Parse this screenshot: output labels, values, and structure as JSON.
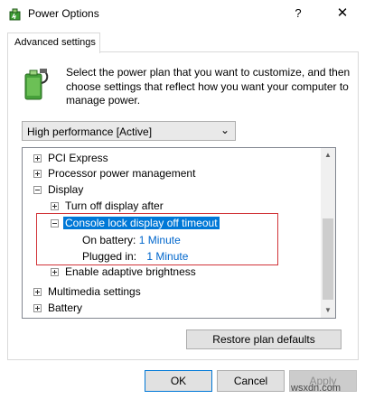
{
  "window": {
    "title": "Power Options",
    "help": "?",
    "close": "✕"
  },
  "tab": {
    "label": "Advanced settings"
  },
  "description": "Select the power plan that you want to customize, and then choose settings that reflect how you want your computer to manage power.",
  "plan_select": {
    "value": "High performance [Active]"
  },
  "tree": {
    "items": [
      {
        "label": "PCI Express"
      },
      {
        "label": "Processor power management"
      },
      {
        "label": "Display"
      },
      {
        "label": "Turn off display after"
      },
      {
        "label": "Console lock display off timeout"
      },
      {
        "label": "On battery:",
        "value": "1 Minute"
      },
      {
        "label": "Plugged in:",
        "value": "1 Minute"
      },
      {
        "label": "Enable adaptive brightness"
      },
      {
        "label": "Multimedia settings"
      },
      {
        "label": "Battery"
      }
    ]
  },
  "buttons": {
    "restore": "Restore plan defaults",
    "ok": "OK",
    "cancel": "Cancel",
    "apply": "Apply"
  },
  "watermark": "wsxdn.com",
  "colors": {
    "selection": "#0078d7",
    "value_link": "#0066cc",
    "highlight_box": "#d13438"
  }
}
